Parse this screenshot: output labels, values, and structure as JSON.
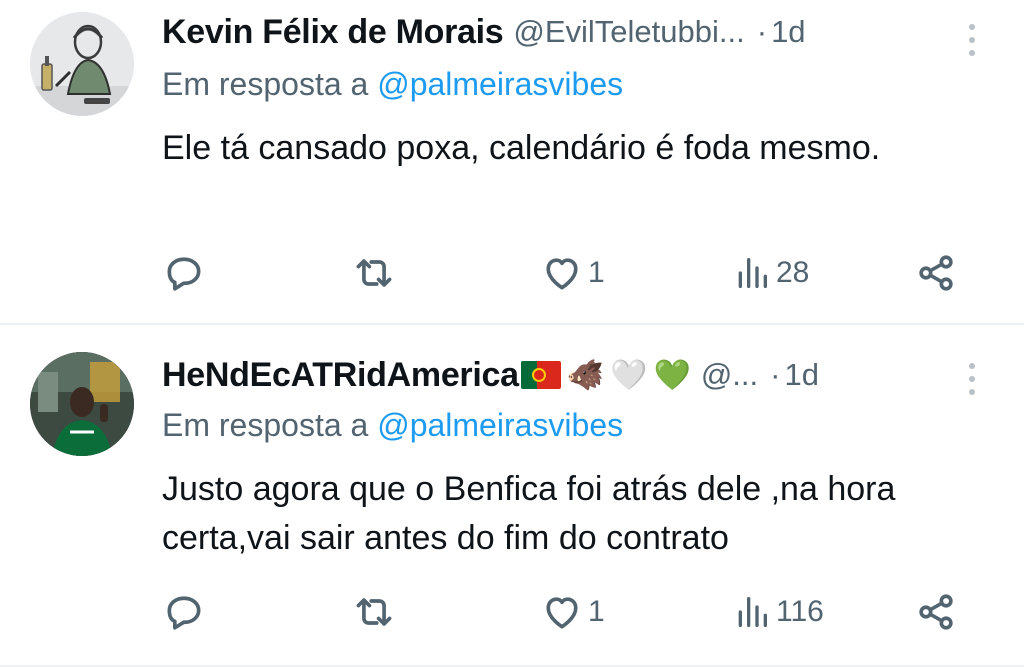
{
  "tweets": [
    {
      "author_name": "Kevin Félix de Morais",
      "handle": "@EvilTeletubbi...",
      "separator": "·",
      "time": "1d",
      "reply_prefix": "Em resposta a",
      "reply_mention": "@palmeirasvibes",
      "text": "Ele tá cansado poxa, calendário é foda mesmo.",
      "replies": "",
      "retweets": "",
      "likes": "1",
      "views": "28"
    },
    {
      "author_name": "HeNdEcATRidAmerica",
      "name_emojis": [
        "🐗",
        "🤍",
        "💚"
      ],
      "handle": "@...",
      "separator": "·",
      "time": "1d",
      "reply_prefix": "Em resposta a",
      "reply_mention": "@palmeirasvibes",
      "text": "Justo agora que o Benfica foi atrás dele ,na hora certa,vai sair antes do fim do contrato",
      "replies": "",
      "retweets": "",
      "likes": "1",
      "views": "116"
    }
  ],
  "colors": {
    "text_primary": "#0f1419",
    "text_secondary": "#536471",
    "mention": "#1d9bf0",
    "divider": "#eef1f3"
  },
  "icons": [
    "reply-icon",
    "retweet-icon",
    "heart-icon",
    "views-icon",
    "share-icon",
    "more-options-icon"
  ]
}
